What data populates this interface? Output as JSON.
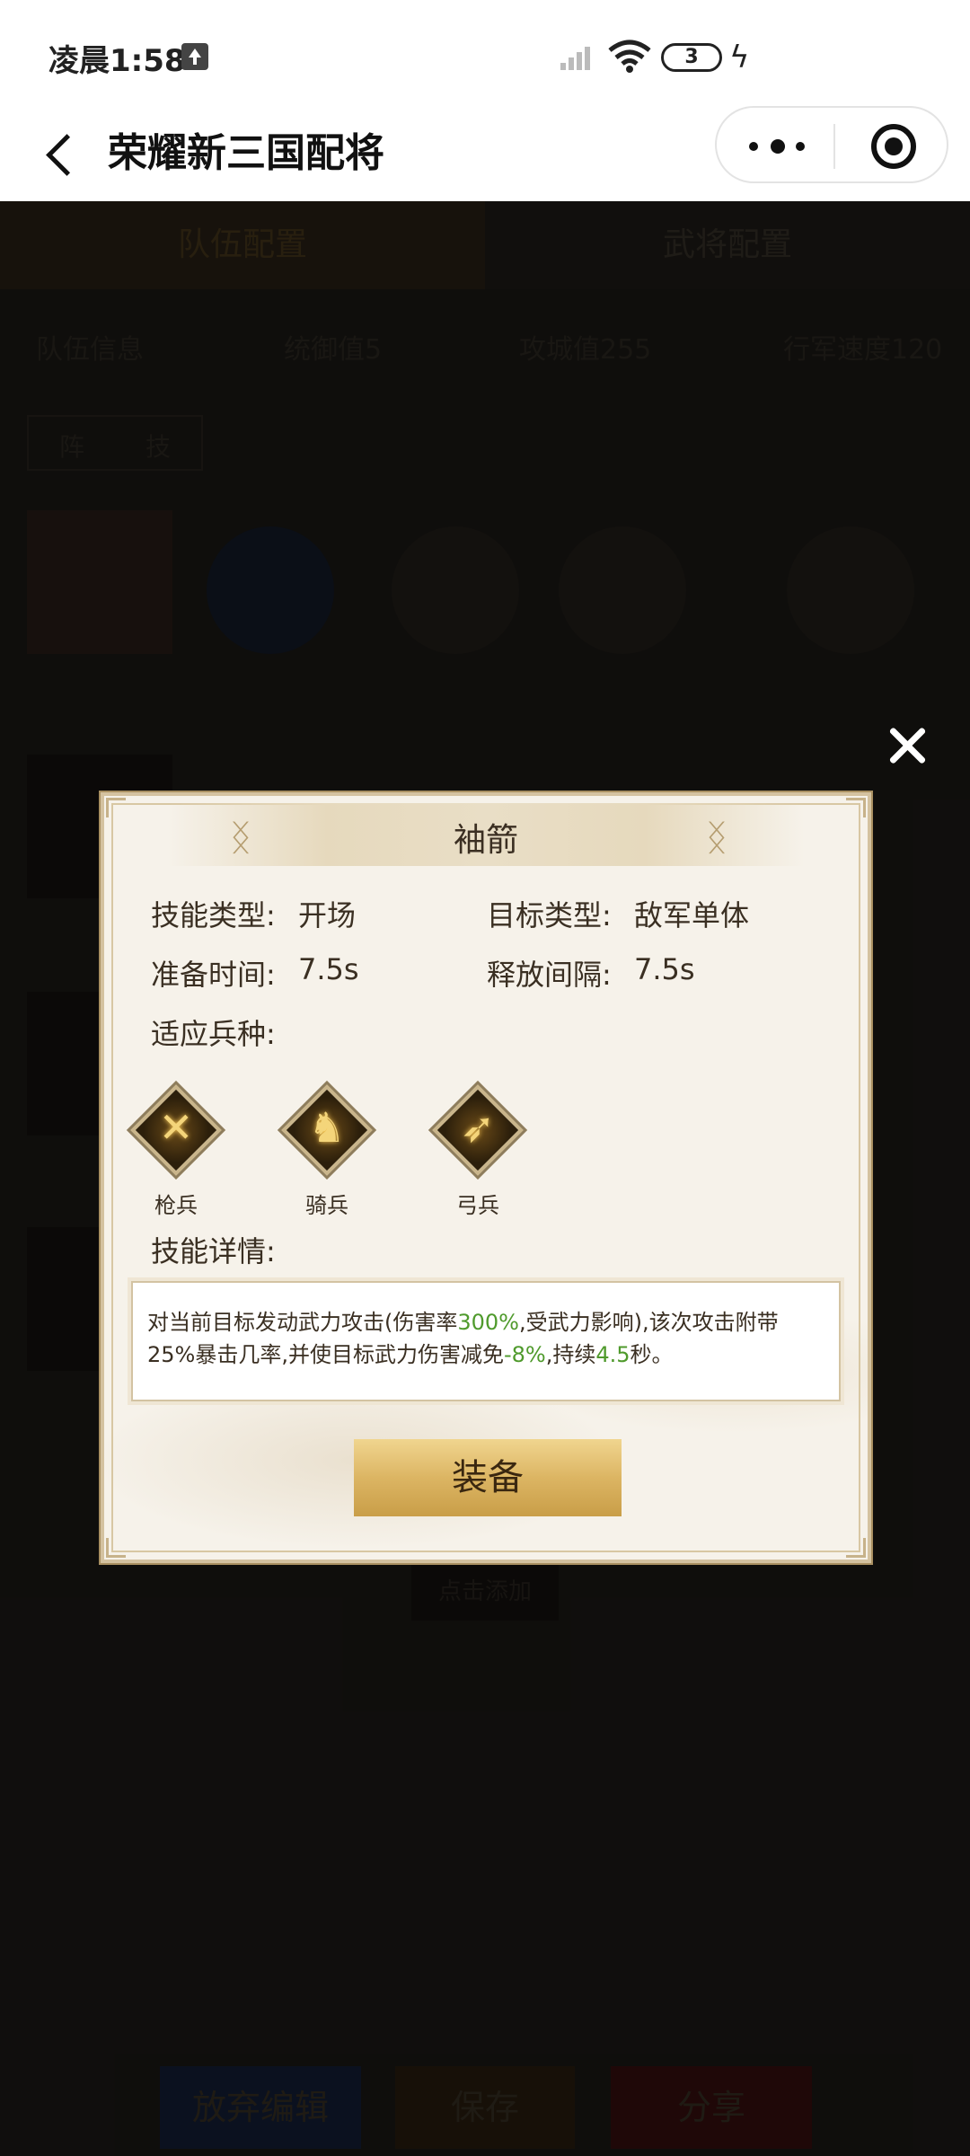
{
  "status_bar": {
    "time": "凌晨1:58",
    "battery": "3"
  },
  "title_bar": {
    "title": "荣耀新三国配将"
  },
  "background": {
    "tabs": [
      "队伍配置",
      "武将配置"
    ],
    "info": [
      "队伍信息",
      "统御值5",
      "攻城值255",
      "行军速度120"
    ],
    "toggle": [
      "阵",
      "技"
    ],
    "slot_label": "点击添加",
    "bottom_buttons": [
      "放弃编辑",
      "保存",
      "分享"
    ]
  },
  "dialog": {
    "title": "袖箭",
    "skill_type_label": "技能类型:",
    "skill_type_value": "开场",
    "target_type_label": "目标类型:",
    "target_type_value": "敌军单体",
    "prep_time_label": "准备时间:",
    "prep_time_value": "7.5s",
    "interval_label": "释放间隔:",
    "interval_value": "7.5s",
    "troops_label": "适应兵种:",
    "troops": [
      {
        "name": "枪兵",
        "icon": "spear-icon"
      },
      {
        "name": "骑兵",
        "icon": "horse-icon"
      },
      {
        "name": "弓兵",
        "icon": "bow-icon"
      }
    ],
    "detail_label": "技能详情:",
    "detail": {
      "part1": "对当前目标发动武力攻击(伤害率",
      "hl1": "300%",
      "part2": ",受武力影响),该次攻击附带25%暴击几率,并使目标武力伤害减免",
      "hl2": "-8%",
      "part3": ",持续",
      "hl3": "4.5",
      "part4": "秒。"
    },
    "equip_button": "装备"
  },
  "colors": {
    "highlight": "#4f9a2c",
    "gold_button": "#dcb563"
  }
}
